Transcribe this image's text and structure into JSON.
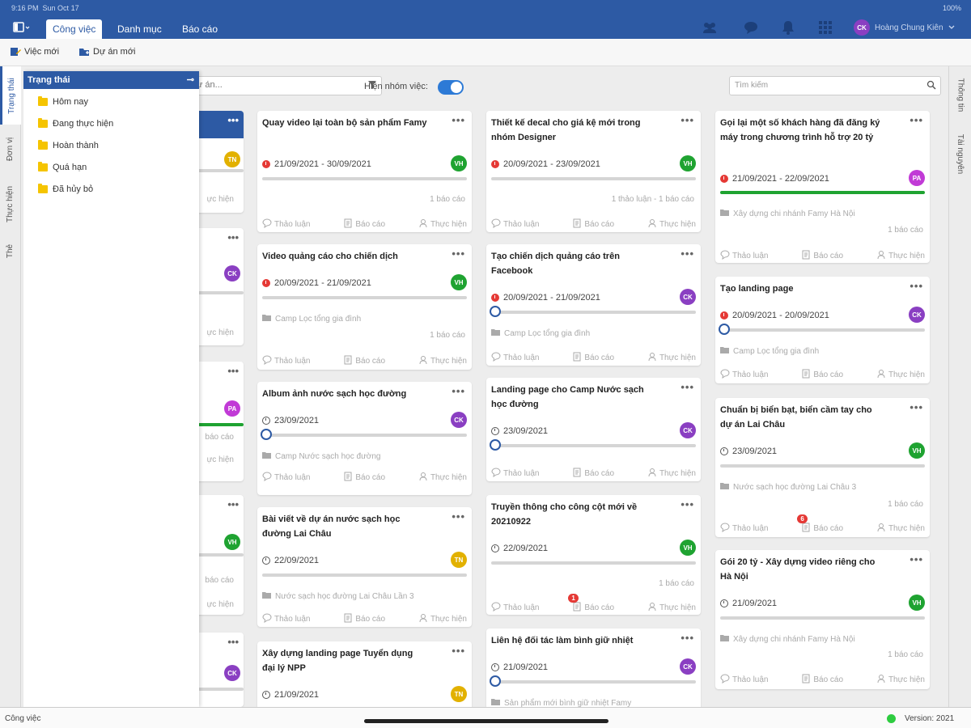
{
  "statusbar": {
    "time": "9:16 PM",
    "date": "Sun Oct 17",
    "battery": "100%"
  },
  "nav": {
    "tabs": [
      "Công việc",
      "Danh mục",
      "Báo cáo"
    ],
    "user_name": "Hoàng Chung Kiên",
    "user_initials": "CK"
  },
  "toolbar": {
    "new_task": "Việc mới",
    "new_project": "Dự án mới"
  },
  "lefttabs": [
    "Trạng thái",
    "Đơn vị",
    "Thực hiện",
    "Thẻ"
  ],
  "righttabs": [
    "Thông tin",
    "Tài nguyên"
  ],
  "filter": {
    "placeholder": "ự án...",
    "group_label": "Hiện nhóm việc:",
    "search_placeholder": "Tìm kiếm"
  },
  "panel": {
    "title": "Trạng thái",
    "items": [
      "Hôm nay",
      "Đang thực hiện",
      "Hoàn thành",
      "Quá hạn",
      "Đã hủy bỏ"
    ]
  },
  "labels": {
    "discuss": "Thảo luận",
    "report": "Báo cáo",
    "assignee": "Thực hiện",
    "reports_one": "1 báo cáo",
    "discuss_report": "1 thảo luận - 1 báo cáo",
    "more": "•••"
  },
  "partial_cards": [
    {
      "av": "TN",
      "color": "#e2b100",
      "status": "ực hiện"
    },
    {
      "av": "CK",
      "color": "#8a3fc2",
      "status": "ực hiện"
    },
    {
      "av": "PA",
      "color": "#c13ad6",
      "report": "báo cáo",
      "status": "ực hiện"
    },
    {
      "av": "VH",
      "color": "#1fa331",
      "report": "báo cáo",
      "status": "ực hiện"
    },
    {
      "av": "CK",
      "color": "#8a3fc2"
    }
  ],
  "cards": [
    {
      "title": "Quay video lại toàn bộ sản phẩm Famy",
      "date": "21/09/2021 - 30/09/2021",
      "av": "VH",
      "color": "#1fa331",
      "overdue": true
    },
    {
      "title": "Video quảng cáo cho chiến dịch",
      "date": "20/09/2021 - 21/09/2021",
      "av": "VH",
      "color": "#1fa331",
      "overdue": true,
      "project": "Camp Lọc tổng gia đình"
    },
    {
      "title": "Album ảnh nước sạch học đường",
      "date": "23/09/2021",
      "av": "CK",
      "color": "#8a3fc2",
      "project": "Camp Nước sạch học đường"
    },
    {
      "title": "Bài viết về dự án nước sạch học đường Lai Châu",
      "date": "22/09/2021",
      "av": "TN",
      "color": "#e2b100",
      "project": "Nước sạch học đường Lai Châu Lần 3"
    },
    {
      "title": "Xây dựng landing page Tuyển dụng đại lý NPP",
      "date": "21/09/2021",
      "av": "TN",
      "color": "#e2b100"
    },
    {
      "title": "Thiết kế decal cho giá kệ mới trong nhóm Designer",
      "date": "20/09/2021 - 23/09/2021",
      "av": "VH",
      "color": "#1fa331",
      "overdue": true
    },
    {
      "title": "Tạo chiến dịch quảng cáo trên Facebook",
      "date": "20/09/2021 - 21/09/2021",
      "av": "CK",
      "color": "#8a3fc2",
      "overdue": true,
      "project": "Camp Lọc tổng gia đình"
    },
    {
      "title": "Landing page cho Camp Nước sạch học đường",
      "date": "23/09/2021",
      "av": "CK",
      "color": "#8a3fc2"
    },
    {
      "title": "Truyền thông cho công cột mới về 20210922",
      "date": "22/09/2021",
      "av": "VH",
      "color": "#1fa331",
      "badge": "1"
    },
    {
      "title": "Liên hệ đối tác làm bình giữ nhiệt",
      "date": "21/09/2021",
      "av": "CK",
      "color": "#8a3fc2",
      "project": "Sản phẩm mới bình giữ nhiệt Famy"
    },
    {
      "title": "Gọi lại một số khách hàng đã đăng ký máy trong chương trình hỗ trợ 20 tỷ",
      "date": "21/09/2021 - 22/09/2021",
      "av": "PA",
      "color": "#c13ad6",
      "overdue": true,
      "project": "Xây dựng chi nhánh Famy Hà Nội"
    },
    {
      "title": "Tạo landing page",
      "date": "20/09/2021 - 20/09/2021",
      "av": "CK",
      "color": "#8a3fc2",
      "overdue": true,
      "project": "Camp Lọc tổng gia đình"
    },
    {
      "title": "Chuẩn bị biển bạt, biển cầm tay cho dự án Lai Châu",
      "date": "23/09/2021",
      "av": "VH",
      "color": "#1fa331",
      "project": "Nước sạch học đường Lai Châu 3",
      "badge": "6"
    },
    {
      "title": "Gói 20 tỷ - Xây dựng video riêng cho Hà Nội",
      "date": "21/09/2021",
      "av": "VH",
      "color": "#1fa331",
      "project": "Xây dựng chi nhánh Famy Hà Nội"
    }
  ],
  "footer": {
    "left": "Công việc",
    "version": "Version: 2021"
  }
}
